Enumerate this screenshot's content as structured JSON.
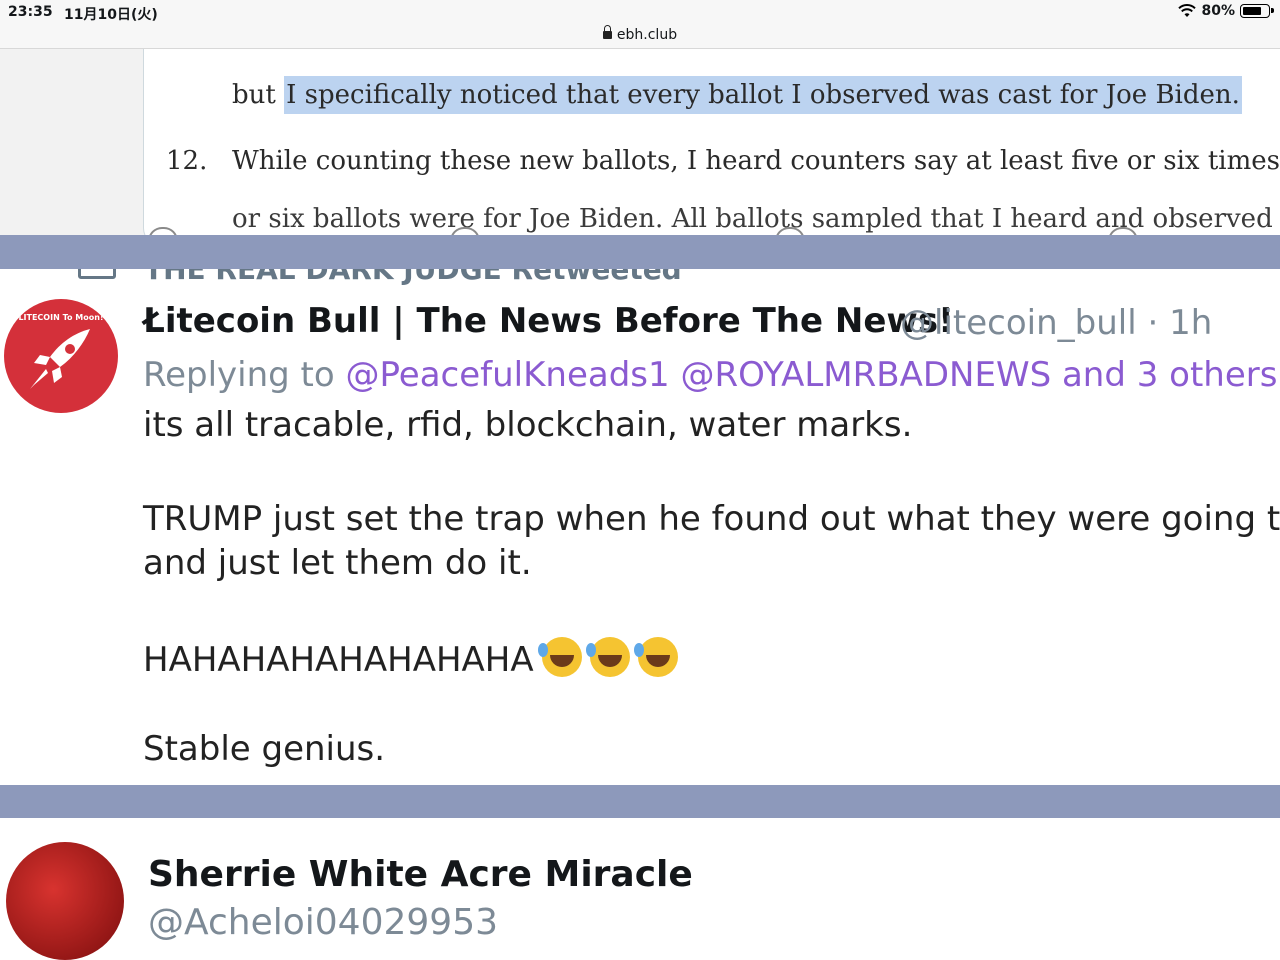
{
  "status_bar": {
    "time": "23:35",
    "date": "11月10日(火)",
    "battery": "80%",
    "battery_level": 0.8
  },
  "browser": {
    "url": "ebh.club"
  },
  "document": {
    "line1_prefix": "but ",
    "line1_highlight": "I specifically noticed that every ballot I observed was cast for Joe Biden.",
    "paragraph_number": "12.",
    "line2": "While counting these new ballots, I heard counters say at least five or six times that all f",
    "line3": "or six ballots were for Joe Biden. All ballots sampled that I heard and observed were for"
  },
  "retweet_banner": {
    "text": "THE REAL DARK JUDGE Retweeted"
  },
  "tweet1": {
    "avatar_text": "LITECOIN To Moon!",
    "name": "Łitecoin Bull | The News Before The News!",
    "handle": "@litecoin_bull · 1h",
    "reply_prefix": "Replying to",
    "reply_mentions": "@PeacefulKneads1 @ROYALMRBADNEWS and 3 others",
    "body_line1": "its all tracable, rfid, blockchain, water marks.",
    "body_line2": "TRUMP just set the trap when he found out what they were going to",
    "body_line3": "and just let them do it.",
    "body_line4": "HAHAHAHAHAHAHAHA",
    "body_line5": "Stable genius."
  },
  "tweet2": {
    "name": "Sherrie White Acre Miracle",
    "handle": "@Acheloi04029953"
  },
  "colors": {
    "separator": "#8d99bb",
    "mention": "#8b5bd1",
    "muted": "#7d8a96",
    "highlight": "#bcd3f0",
    "avatar_red": "#d4303a"
  }
}
